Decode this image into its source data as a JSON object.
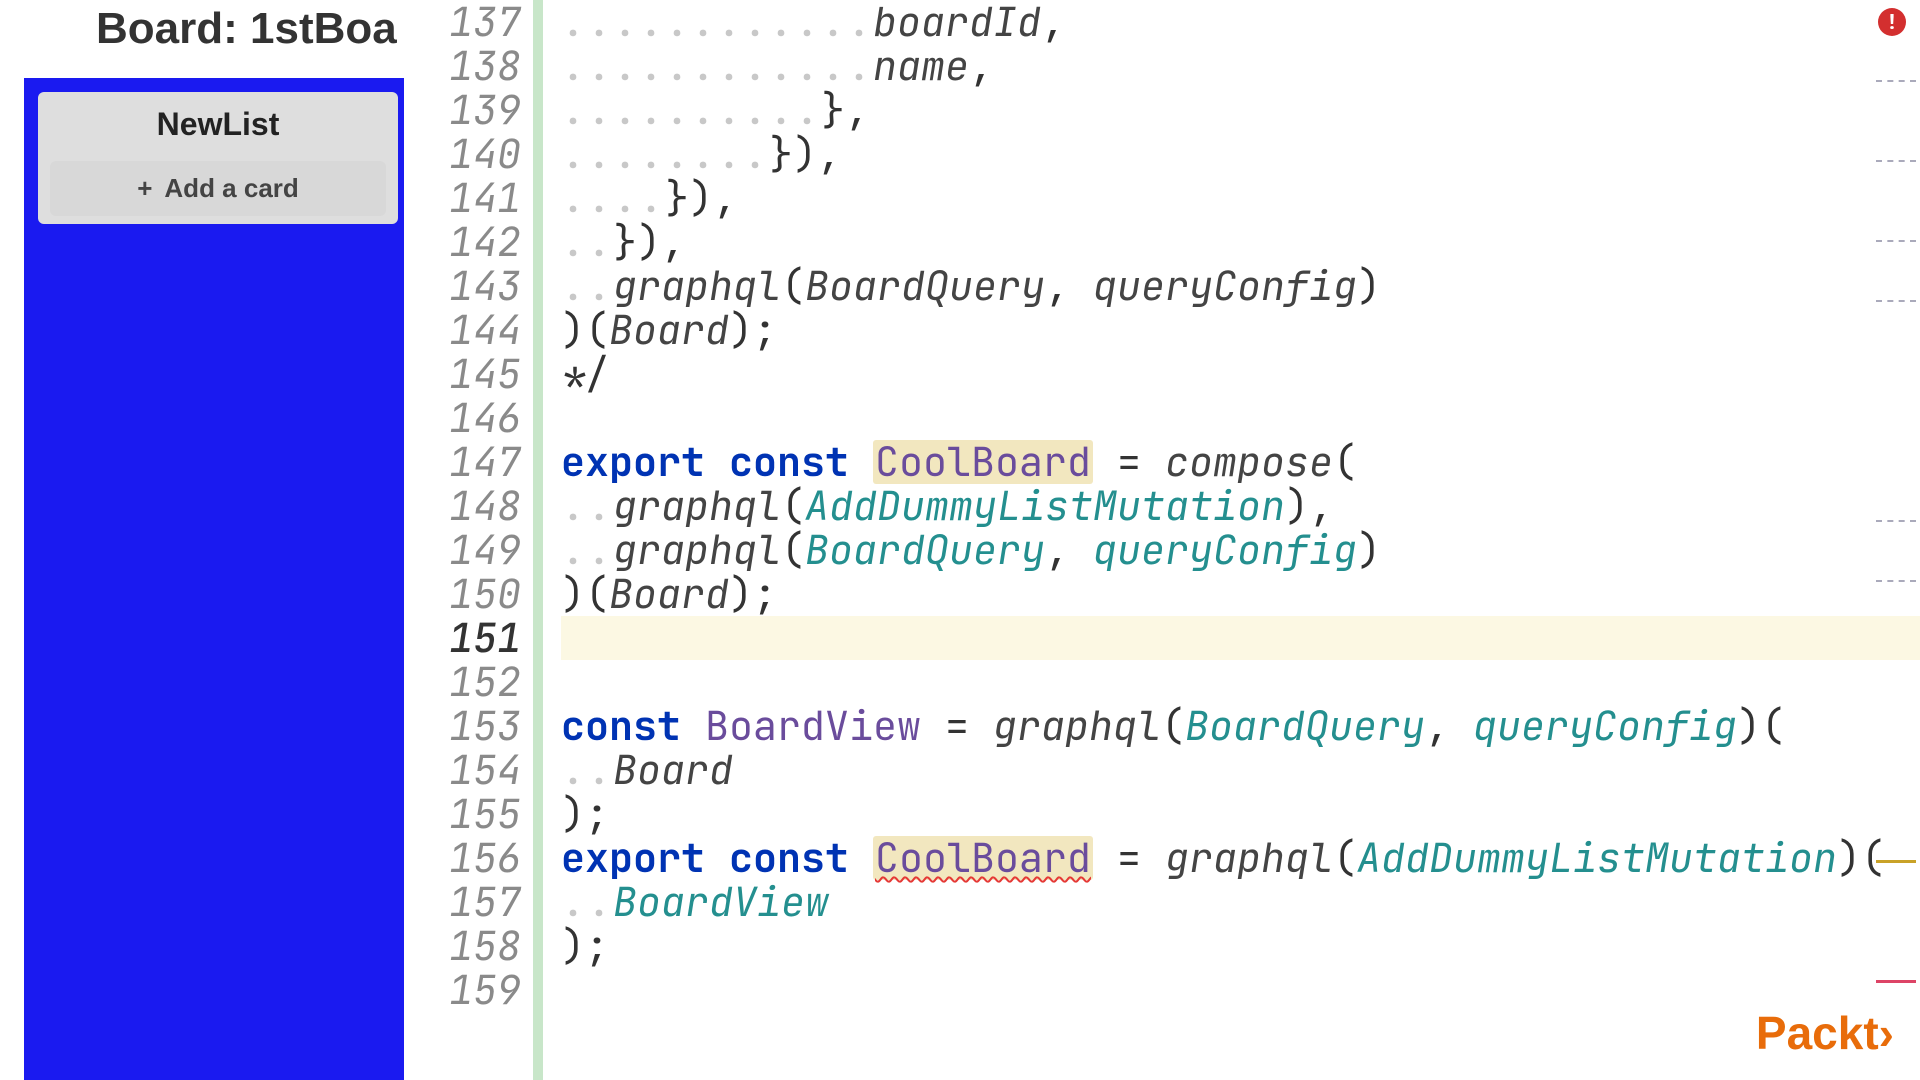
{
  "board": {
    "title": "Board: 1stBoa",
    "list_title": "NewList",
    "add_card_label": "Add a card"
  },
  "editor": {
    "first_line_number": 137,
    "last_line_number": 159,
    "current_line": 151,
    "error_indicator": "!",
    "lines": {
      "l137": {
        "indent": 12,
        "tokens": [
          {
            "t": "boardId",
            "c": "param"
          },
          {
            "t": ",",
            "c": "punct"
          }
        ]
      },
      "l138": {
        "indent": 12,
        "tokens": [
          {
            "t": "name",
            "c": "param"
          },
          {
            "t": ",",
            "c": "punct"
          }
        ]
      },
      "l139": {
        "indent": 10,
        "tokens": [
          {
            "t": "},",
            "c": "punct"
          }
        ]
      },
      "l140": {
        "indent": 8,
        "tokens": [
          {
            "t": "}),",
            "c": "punct"
          }
        ]
      },
      "l141": {
        "indent": 4,
        "tokens": [
          {
            "t": "}),",
            "c": "punct"
          }
        ]
      },
      "l142": {
        "indent": 2,
        "tokens": [
          {
            "t": "}),",
            "c": "punct"
          }
        ]
      },
      "l143": {
        "indent": 2,
        "tokens": [
          {
            "t": "graphql",
            "c": "fn"
          },
          {
            "t": "(",
            "c": "punct"
          },
          {
            "t": "BoardQuery",
            "c": "param"
          },
          {
            "t": ", ",
            "c": "punct"
          },
          {
            "t": "queryConfig",
            "c": "param"
          },
          {
            "t": ")",
            "c": "punct"
          }
        ]
      },
      "l144": {
        "indent": 0,
        "tokens": [
          {
            "t": ")(",
            "c": "punct"
          },
          {
            "t": "Board",
            "c": "param"
          },
          {
            "t": ");",
            "c": "punct"
          }
        ]
      },
      "l145": {
        "indent": 0,
        "tokens": [
          {
            "t": "*/",
            "c": "punct"
          }
        ]
      },
      "l146": {
        "indent": 0,
        "tokens": []
      },
      "l147": {
        "indent": 0,
        "tokens": [
          {
            "t": "export ",
            "c": "kw"
          },
          {
            "t": "const ",
            "c": "kw"
          },
          {
            "t": "CoolBoard",
            "c": "def",
            "hl": true
          },
          {
            "t": " = ",
            "c": "punct"
          },
          {
            "t": "compose",
            "c": "fn"
          },
          {
            "t": "(",
            "c": "punct"
          }
        ]
      },
      "l148": {
        "indent": 2,
        "tokens": [
          {
            "t": "graphql",
            "c": "fn"
          },
          {
            "t": "(",
            "c": "punct"
          },
          {
            "t": "AddDummyListMutation",
            "c": "ident"
          },
          {
            "t": "),",
            "c": "punct"
          }
        ]
      },
      "l149": {
        "indent": 2,
        "tokens": [
          {
            "t": "graphql",
            "c": "fn"
          },
          {
            "t": "(",
            "c": "punct"
          },
          {
            "t": "BoardQuery",
            "c": "ident"
          },
          {
            "t": ", ",
            "c": "punct"
          },
          {
            "t": "queryConfig",
            "c": "ident"
          },
          {
            "t": ")",
            "c": "punct"
          }
        ]
      },
      "l150": {
        "indent": 0,
        "tokens": [
          {
            "t": ")(",
            "c": "punct"
          },
          {
            "t": "Board",
            "c": "param"
          },
          {
            "t": ");",
            "c": "punct"
          }
        ]
      },
      "l151": {
        "indent": 0,
        "tokens": []
      },
      "l152": {
        "indent": 0,
        "tokens": []
      },
      "l153": {
        "indent": 0,
        "tokens": [
          {
            "t": "const ",
            "c": "kw"
          },
          {
            "t": "BoardView",
            "c": "def"
          },
          {
            "t": " = ",
            "c": "punct"
          },
          {
            "t": "graphql",
            "c": "fn"
          },
          {
            "t": "(",
            "c": "punct"
          },
          {
            "t": "BoardQuery",
            "c": "ident"
          },
          {
            "t": ", ",
            "c": "punct"
          },
          {
            "t": "queryConfig",
            "c": "ident"
          },
          {
            "t": ")(",
            "c": "punct"
          }
        ]
      },
      "l154": {
        "indent": 2,
        "tokens": [
          {
            "t": "Board",
            "c": "param"
          }
        ]
      },
      "l155": {
        "indent": 0,
        "tokens": [
          {
            "t": ");",
            "c": "punct"
          }
        ]
      },
      "l156": {
        "indent": 0,
        "tokens": [
          {
            "t": "export ",
            "c": "kw"
          },
          {
            "t": "const ",
            "c": "kw"
          },
          {
            "t": "CoolBoard",
            "c": "def",
            "err": true
          },
          {
            "t": " = ",
            "c": "punct"
          },
          {
            "t": "graphql",
            "c": "fn"
          },
          {
            "t": "(",
            "c": "punct"
          },
          {
            "t": "AddDummyListMutation",
            "c": "ident"
          },
          {
            "t": ")(",
            "c": "punct"
          }
        ]
      },
      "l157": {
        "indent": 2,
        "tokens": [
          {
            "t": "BoardView",
            "c": "ident"
          }
        ]
      },
      "l158": {
        "indent": 0,
        "tokens": [
          {
            "t": ");",
            "c": "punct"
          }
        ]
      },
      "l159": {
        "indent": 0,
        "tokens": []
      }
    }
  },
  "brand": "Packt›"
}
